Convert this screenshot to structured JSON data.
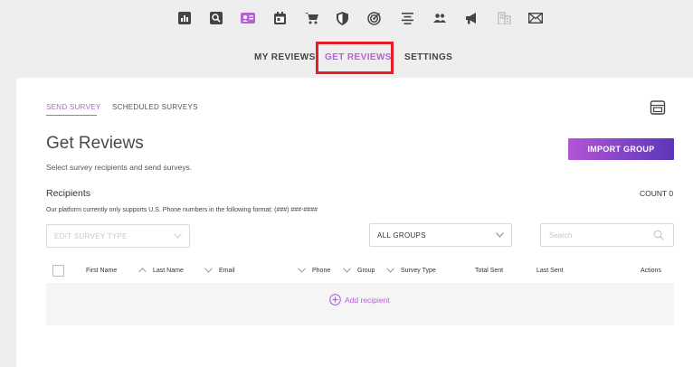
{
  "nav": {
    "icons": [
      "reports-icon",
      "search-icon",
      "contact-card-icon",
      "calendar-icon",
      "cart-icon",
      "shield-icon",
      "target-icon",
      "align-center-icon",
      "users-icon",
      "megaphone-icon",
      "building-icon",
      "mail-icon"
    ],
    "active_icon": "contact-card-icon",
    "accent": "#b562d6"
  },
  "subnav": {
    "tabs": [
      {
        "label": "MY REVIEWS",
        "active": false
      },
      {
        "label": "GET REVIEWS",
        "active": true
      },
      {
        "label": "SETTINGS",
        "active": false
      }
    ]
  },
  "subtabs": [
    {
      "label": "SEND SURVEY",
      "active": true
    },
    {
      "label": "SCHEDULED SURVEYS",
      "active": false
    }
  ],
  "page": {
    "title": "Get Reviews",
    "subtitle": "Select survey recipients and send surveys.",
    "import_label": "IMPORT GROUP"
  },
  "recipients": {
    "title": "Recipients",
    "count_label": "COUNT 0",
    "note": "Our platform currently only supports U.S. Phone numbers in the following format: (###) ###-####"
  },
  "filters": {
    "survey_type_placeholder": "EDIT SURVEY TYPE",
    "groups_value": "ALL GROUPS",
    "search_placeholder": "Search"
  },
  "table": {
    "columns": [
      "First Name",
      "Last Name",
      "Email",
      "Phone",
      "Group",
      "Survey Type",
      "Total Sent",
      "Last Sent",
      "Actions"
    ],
    "add_label": "Add recipient"
  }
}
